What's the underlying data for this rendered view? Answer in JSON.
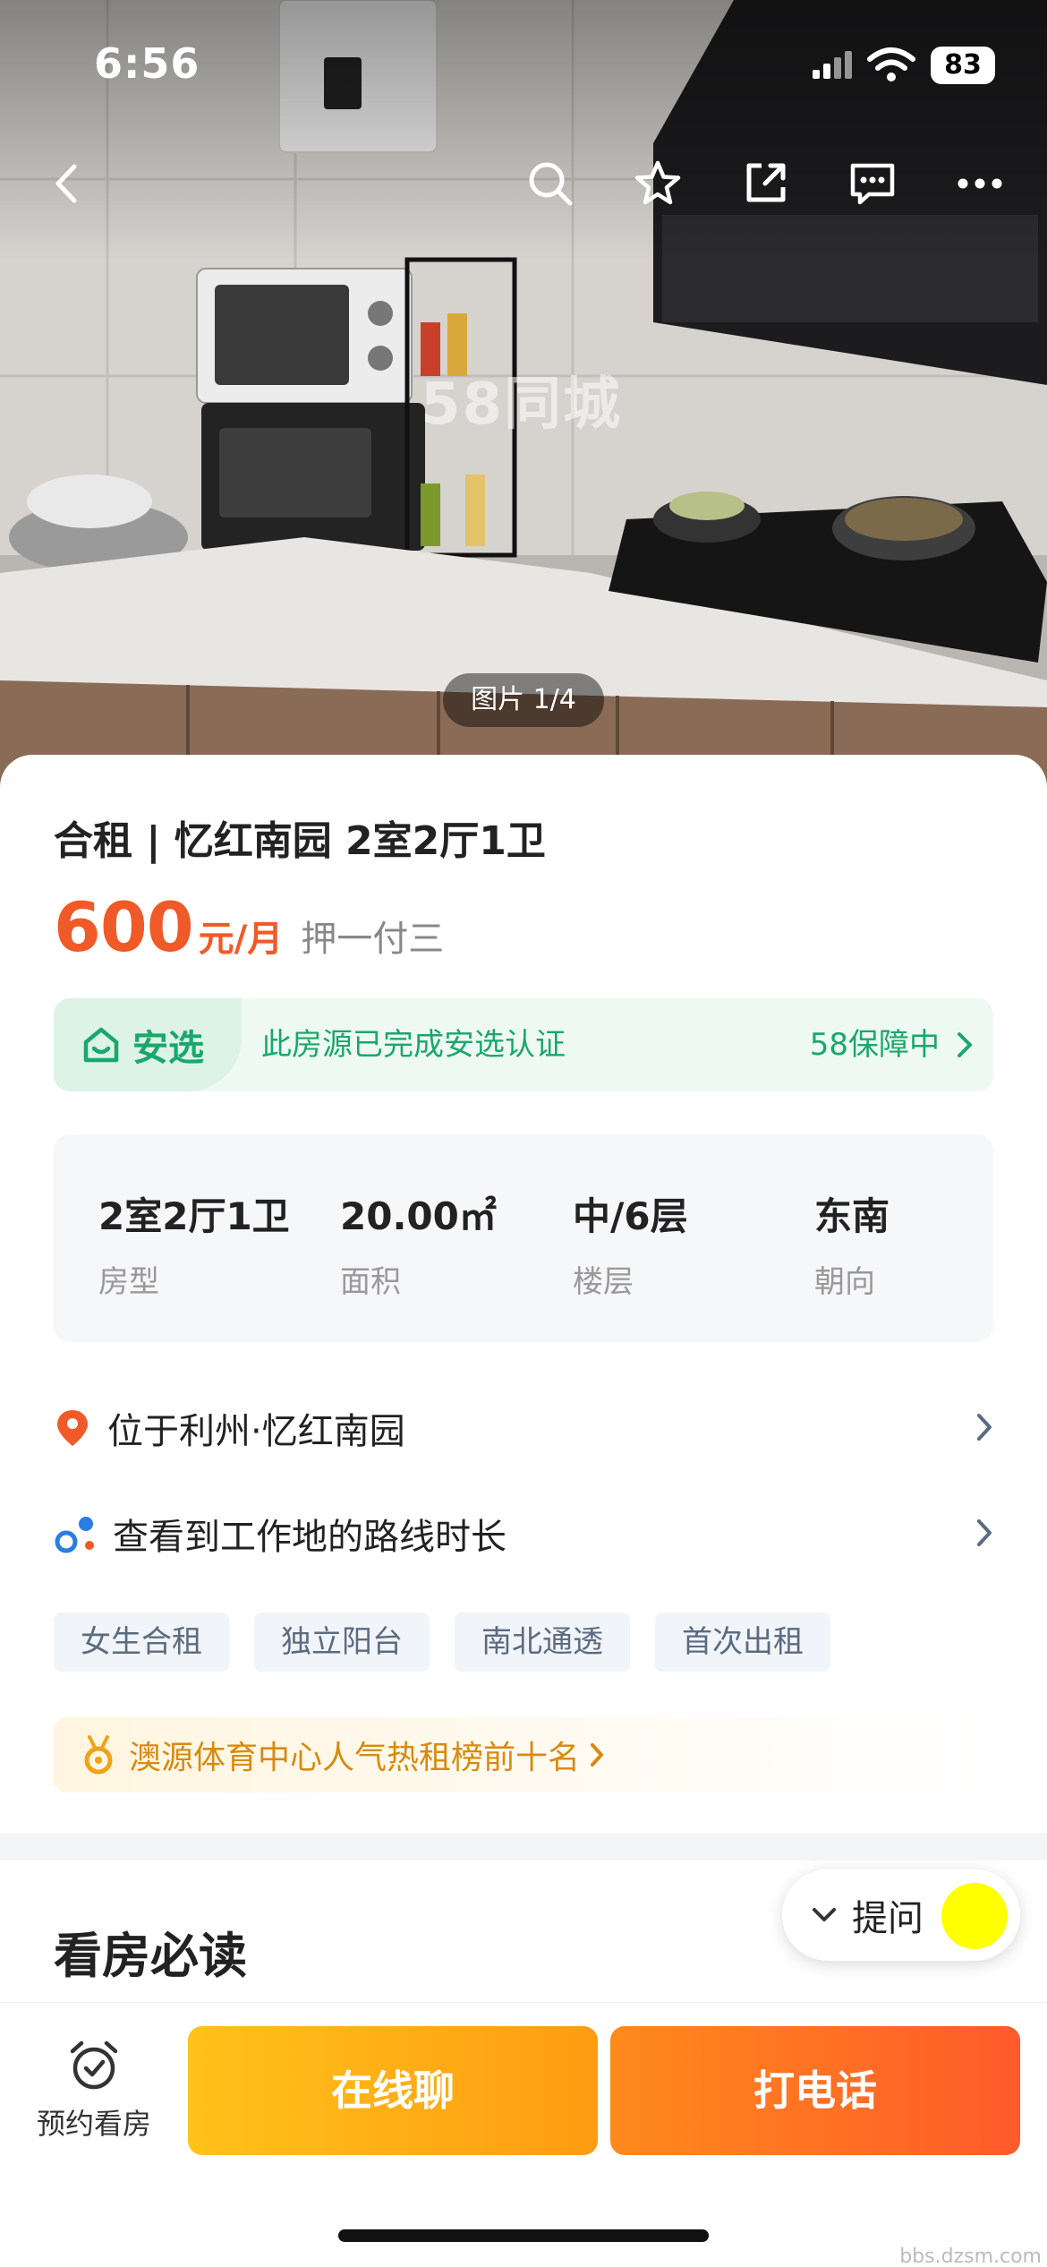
{
  "status_bar": {
    "time": "6:56",
    "battery": "83"
  },
  "hero": {
    "watermark": "58同城",
    "image_counter": "图片 1/4",
    "nav_icons": [
      "back-icon",
      "search-icon",
      "star-icon",
      "share-icon",
      "message-icon",
      "more-icon"
    ]
  },
  "listing": {
    "title": "合租 | 忆红南园 2室2厅1卫",
    "price": "600",
    "price_unit": "元/月",
    "deposit": "押一付三"
  },
  "anxuan": {
    "tag": "安选",
    "description": "此房源已完成安选认证",
    "guarantee": "58保障中"
  },
  "facts": [
    {
      "value": "2室2厅1卫",
      "label": "房型"
    },
    {
      "value": "20.00㎡",
      "label": "面积"
    },
    {
      "value": "中/6层",
      "label": "楼层"
    },
    {
      "value": "东南",
      "label": "朝向"
    }
  ],
  "links": {
    "location": "位于利州·忆红南园",
    "commute": "查看到工作地的路线时长"
  },
  "tags": [
    "女生合租",
    "独立阳台",
    "南北通透",
    "首次出租"
  ],
  "ranking": {
    "text": "澳源体育中心人气热租榜前十名"
  },
  "section": {
    "title": "看房必读"
  },
  "ask": {
    "label": "提问"
  },
  "bottom_bar": {
    "visit_label": "预约看房",
    "chat_label": "在线聊",
    "call_label": "打电话"
  },
  "footer_mark": "bbs.dzsm.com",
  "colors": {
    "price": "#f05a28",
    "anxuan_green": "#1aa86a",
    "chat_yellow": "#ffb217",
    "call_orange": "#ff6a24"
  }
}
